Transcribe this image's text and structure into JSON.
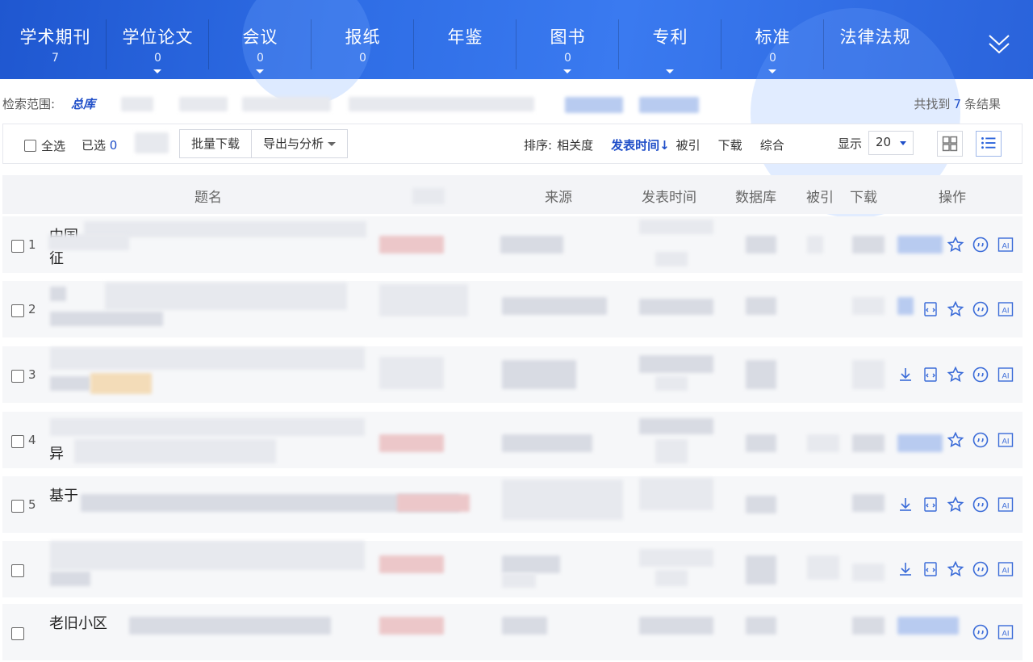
{
  "nav": {
    "categories": [
      {
        "label": "学术期刊",
        "count": "7"
      },
      {
        "label": "学位论文",
        "count": "0"
      },
      {
        "label": "会议",
        "count": "0"
      },
      {
        "label": "报纸",
        "count": "0"
      },
      {
        "label": "年鉴",
        "count": ""
      },
      {
        "label": "图书",
        "count": "0"
      },
      {
        "label": "专利",
        "count": ""
      },
      {
        "label": "标准",
        "count": "0"
      },
      {
        "label": "法律法规",
        "count": ""
      }
    ],
    "collapse_icon": "double-chevron-down-icon"
  },
  "scope": {
    "label": "检索范围:",
    "value": "总库"
  },
  "results": {
    "prefix": "共找到",
    "count": "7",
    "suffix": "条结果"
  },
  "toolbar": {
    "select_all": "全选",
    "selected_label": "已选",
    "selected_count": "0",
    "batch_download": "批量下载",
    "export_analysis": "导出与分析",
    "sort_label": "排序:",
    "sort_options": [
      "相关度",
      "发表时间↓",
      "被引",
      "下载",
      "综合"
    ],
    "sort_active": "发表时间↓",
    "display_label": "显示",
    "display_value": "20"
  },
  "table": {
    "headers": {
      "title": "题名",
      "source": "来源",
      "date": "发表时间",
      "database": "数据库",
      "cited": "被引",
      "downloads": "下载",
      "actions": "操作"
    },
    "rows": [
      {
        "index": "1",
        "title_visible": [
          "中国",
          "征"
        ],
        "actions": [
          "star-icon",
          "quote-icon",
          "ai-icon"
        ]
      },
      {
        "index": "2",
        "title_visible": [
          "",
          ""
        ],
        "actions": [
          "html-read-icon",
          "star-icon",
          "quote-icon",
          "ai-icon"
        ]
      },
      {
        "index": "3",
        "title_visible": [
          "",
          ""
        ],
        "actions": [
          "download-icon",
          "html-read-icon",
          "star-icon",
          "quote-icon",
          "ai-icon"
        ]
      },
      {
        "index": "4",
        "title_visible": [
          "",
          "异"
        ],
        "actions": [
          "star-icon",
          "quote-icon",
          "ai-icon"
        ]
      },
      {
        "index": "5",
        "title_visible": [
          "基于",
          ""
        ],
        "actions": [
          "download-icon",
          "html-read-icon",
          "star-icon",
          "quote-icon",
          "ai-icon"
        ]
      },
      {
        "index": "",
        "title_visible": [
          "",
          ""
        ],
        "actions": [
          "download-icon",
          "html-read-icon",
          "star-icon",
          "quote-icon",
          "ai-icon"
        ]
      },
      {
        "index": "",
        "title_visible": [
          "老旧小区",
          ""
        ],
        "actions": [
          "quote-icon",
          "ai-icon"
        ]
      }
    ]
  },
  "colors": {
    "brand_blue": "#2a63db",
    "accent_text": "#1f4ec8",
    "row_background": "#f6f7f9"
  }
}
